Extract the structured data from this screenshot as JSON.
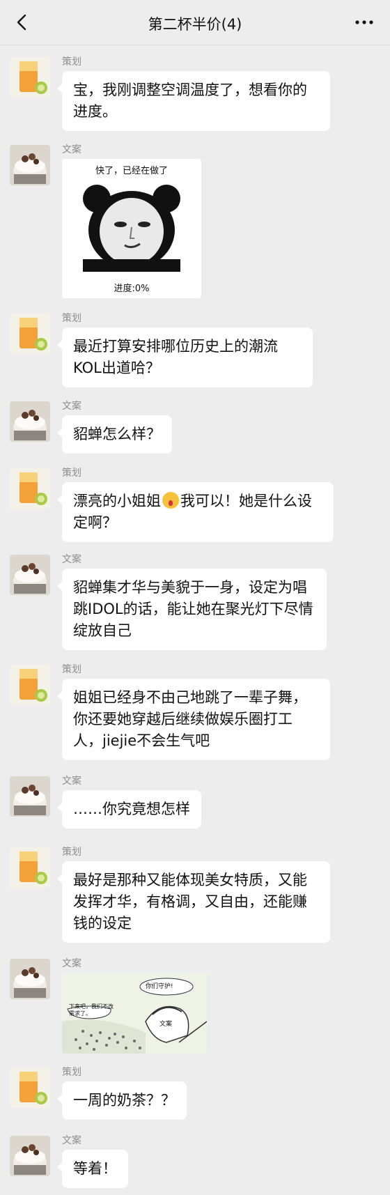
{
  "header": {
    "title": "第二杯半价(4)"
  },
  "messages": [
    {
      "sender": "策划",
      "text": "宝，我刚调整空调温度了，想看你的进度。"
    },
    {
      "sender": "文案",
      "sticker": {
        "top_text": "快了，已经在做了",
        "bottom_text": "进度:0%"
      }
    },
    {
      "sender": "策划",
      "text": "最近打算安排哪位历史上的潮流KOL出道哈？"
    },
    {
      "sender": "文案",
      "text": "貂蝉怎么样？"
    },
    {
      "sender": "策划",
      "text_before": "漂亮的小姐姐",
      "emoji": "astonished-face",
      "text_after": "我可以！她是什么设定啊？"
    },
    {
      "sender": "文案",
      "text": "貂蝉集才华与美貌于一身，设定为唱跳IDOL的话，能让她在聚光灯下尽情绽放自己"
    },
    {
      "sender": "策划",
      "text": "姐姐已经身不由己地跳了一辈子舞，你还要她穿越后继续做娱乐圈打工人，jiejie不会生气吧"
    },
    {
      "sender": "文案",
      "text": "……你究竟想怎样"
    },
    {
      "sender": "策划",
      "text": "最好是那种又能体现美女特质，又能发挥才华，有格调，又自由，还能赚钱的设定"
    },
    {
      "sender": "文案",
      "sticker": {
        "speech_top": "你们守护!",
        "speech_left": "下来吧，我们不改需求了。",
        "helmet_label": "文案"
      }
    },
    {
      "sender": "策划",
      "text": "一周的奶茶？？"
    },
    {
      "sender": "文案",
      "text": "等着！"
    }
  ],
  "colors": {
    "background": "#ededed",
    "bubble": "#ffffff",
    "name": "#8c8c8c"
  }
}
